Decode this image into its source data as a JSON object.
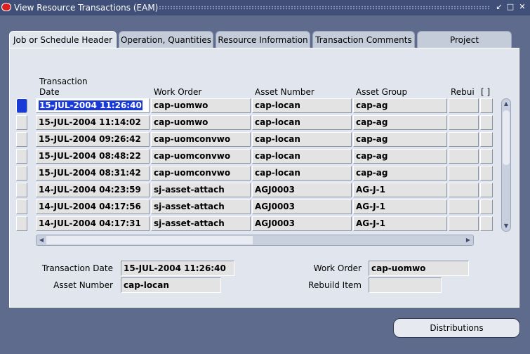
{
  "window": {
    "title": "View Resource Transactions (EAM)",
    "controls": [
      "restore-icon",
      "minimize-icon",
      "close-icon"
    ]
  },
  "tabs": [
    {
      "label": "Job or Schedule Header",
      "active": true
    },
    {
      "label": "Operation, Quantities",
      "active": false
    },
    {
      "label": "Resource Information",
      "active": false
    },
    {
      "label": "Transaction Comments",
      "active": false
    },
    {
      "label": "Project",
      "active": false
    }
  ],
  "grid": {
    "columns": {
      "date_line1": "Transaction",
      "date_line2": "Date",
      "work_order": "Work Order",
      "asset_number": "Asset Number",
      "asset_group": "Asset Group",
      "rebuild": "Rebui",
      "flex": "[ ]"
    },
    "rows": [
      {
        "date": "15-JUL-2004 11:26:40",
        "work_order": "cap-uomwo",
        "asset_number": "cap-locan",
        "asset_group": "cap-ag"
      },
      {
        "date": "15-JUL-2004 11:14:02",
        "work_order": "cap-uomwo",
        "asset_number": "cap-locan",
        "asset_group": "cap-ag"
      },
      {
        "date": "15-JUL-2004 09:26:42",
        "work_order": "cap-uomconvwo",
        "asset_number": "cap-locan",
        "asset_group": "cap-ag"
      },
      {
        "date": "15-JUL-2004 08:48:22",
        "work_order": "cap-uomconvwo",
        "asset_number": "cap-locan",
        "asset_group": "cap-ag"
      },
      {
        "date": "15-JUL-2004 08:31:42",
        "work_order": "cap-uomconvwo",
        "asset_number": "cap-locan",
        "asset_group": "cap-ag"
      },
      {
        "date": "14-JUL-2004 04:23:59",
        "work_order": "sj-asset-attach",
        "asset_number": "AGJ0003",
        "asset_group": "AG-J-1"
      },
      {
        "date": "14-JUL-2004 04:17:56",
        "work_order": "sj-asset-attach",
        "asset_number": "AGJ0003",
        "asset_group": "AG-J-1"
      },
      {
        "date": "14-JUL-2004 04:17:31",
        "work_order": "sj-asset-attach",
        "asset_number": "AGJ0003",
        "asset_group": "AG-J-1"
      }
    ]
  },
  "detail": {
    "transaction_date_label": "Transaction Date",
    "transaction_date_value": "15-JUL-2004 11:26:40",
    "asset_number_label": "Asset Number",
    "asset_number_value": "cap-locan",
    "work_order_label": "Work Order",
    "work_order_value": "cap-uomwo",
    "rebuild_item_label": "Rebuild Item",
    "rebuild_item_value": ""
  },
  "buttons": {
    "distributions": "Distributions"
  }
}
